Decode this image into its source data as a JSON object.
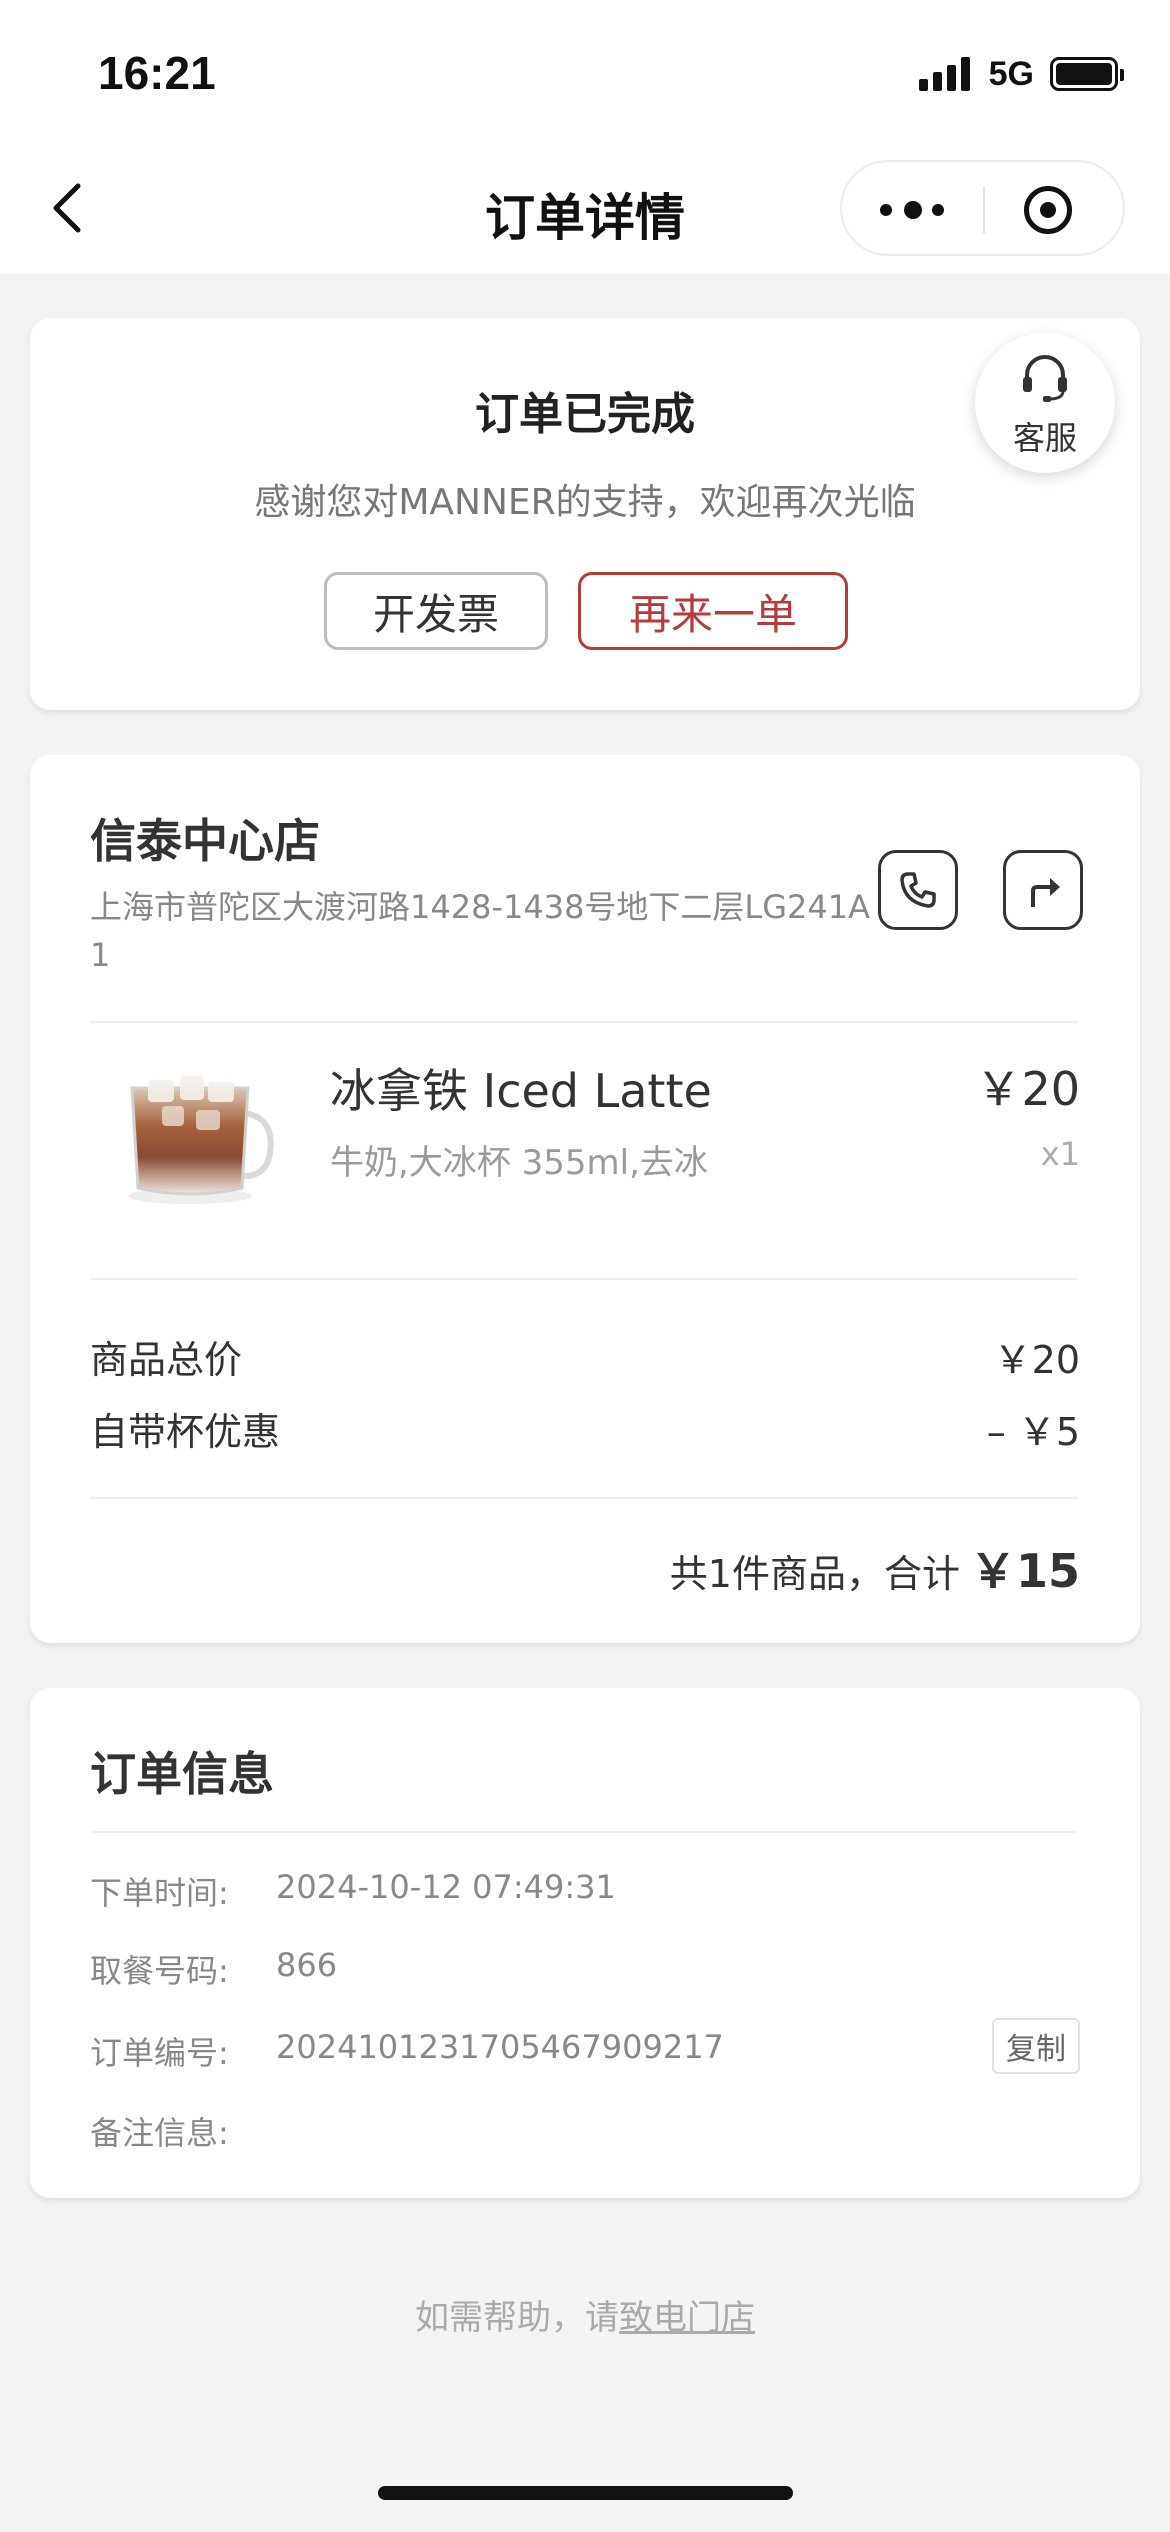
{
  "status_bar": {
    "time": "16:21",
    "network": "5G"
  },
  "nav": {
    "title": "订单详情"
  },
  "order_status": {
    "title": "订单已完成",
    "thanks": "感谢您对MANNER的支持，欢迎再次光临",
    "invoice_label": "开发票",
    "reorder_label": "再来一单",
    "service_label": "客服"
  },
  "store": {
    "name": "信泰中心店",
    "address": "上海市普陀区大渡河路1428-1438号地下二层LG241A1"
  },
  "product": {
    "name": "冰拿铁 Iced Latte",
    "price": "￥20",
    "spec": "牛奶,大冰杯 355ml,去冰",
    "qty": "x1",
    "image": "iced-latte-cup"
  },
  "summary": {
    "goods_total_label": "商品总价",
    "goods_total_value": "￥20",
    "discount_label": "自带杯优惠",
    "discount_value": "– ￥5",
    "total_text": "共1件商品，合计",
    "total_amount": "￥15"
  },
  "order_info": {
    "title": "订单信息",
    "order_time_label": "下单时间:",
    "order_time_value": "2024-10-12 07:49:31",
    "pickup_label": "取餐号码:",
    "pickup_value": "866",
    "order_no_label": "订单编号:",
    "order_no_value": "2024101231705467909217",
    "copy_label": "复制",
    "note_label": "备注信息:"
  },
  "help": {
    "prefix": "如需帮助，请",
    "link": "致电门店"
  },
  "colors": {
    "accent": "#b63b3c",
    "background": "#f3f3f3"
  }
}
